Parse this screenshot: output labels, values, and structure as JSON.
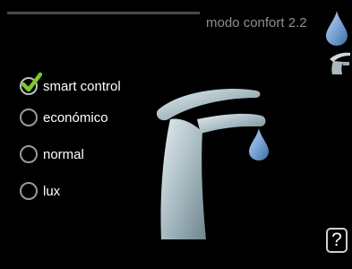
{
  "header": {
    "title": "modo confort 2.2"
  },
  "tabs": [
    {
      "icon": "water-drop-icon"
    },
    {
      "icon": "faucet-icon"
    }
  ],
  "options": [
    {
      "label": "smart control",
      "checked": true
    },
    {
      "label": "económico",
      "checked": false
    },
    {
      "label": "normal",
      "checked": false
    },
    {
      "label": "lux",
      "checked": false
    }
  ],
  "illustration": {
    "icon": "faucet-with-drop-icon"
  },
  "help": {
    "label": "?"
  },
  "colors": {
    "background": "#000000",
    "accent_drop": "#6f9bcf",
    "check": "#7cc62f",
    "title": "#8f8f8f"
  }
}
